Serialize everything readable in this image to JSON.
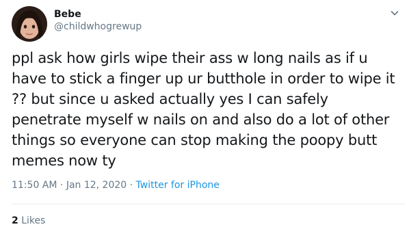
{
  "tweet": {
    "author_name": "Bebe",
    "author_handle": "@childwhogrewup",
    "text": "ppl ask how girls wipe their ass w long nails as if u have to stick a finger up ur butthole in order to wipe it ?? but since u asked actually yes I can safely penetrate myself w nails on and also do a lot of other things so everyone can stop making the poopy butt memes now ty",
    "time": "11:50 AM",
    "separator": "·",
    "date": "Jan 12, 2020",
    "source": "Twitter for iPhone",
    "likes_count": "2",
    "likes_label": "Likes"
  },
  "icons": {
    "avatar": "profile-photo",
    "caret": "chevron-down-icon"
  },
  "colors": {
    "text_primary": "#14171a",
    "text_secondary": "#657786",
    "link": "#1b95e0",
    "divider": "#e6ecf0"
  }
}
